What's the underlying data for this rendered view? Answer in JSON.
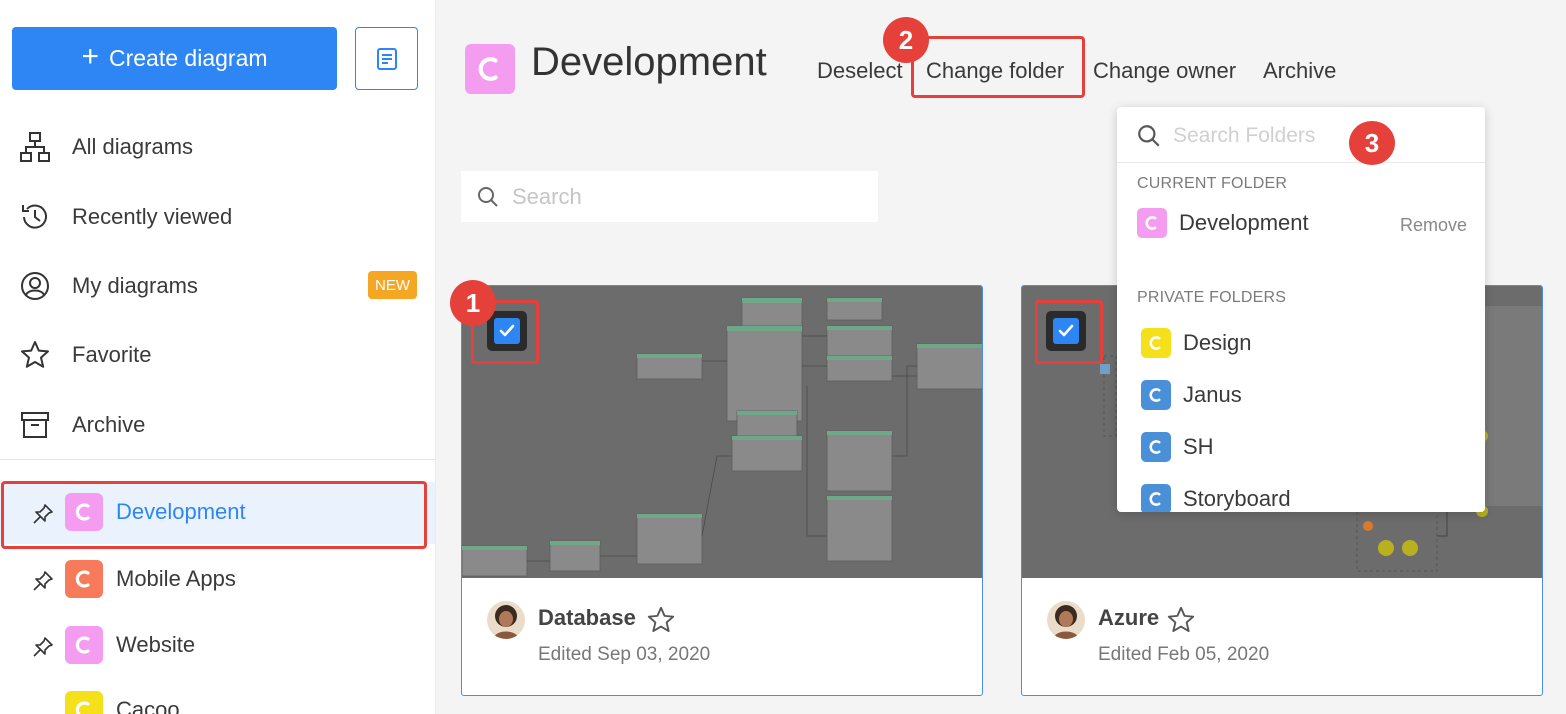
{
  "sidebar": {
    "create_label": "Create diagram",
    "nav": [
      {
        "label": "All diagrams",
        "icon": "hierarchy-icon"
      },
      {
        "label": "Recently viewed",
        "icon": "history-icon"
      },
      {
        "label": "My diagrams",
        "icon": "user-circle-icon",
        "badge": "NEW"
      },
      {
        "label": "Favorite",
        "icon": "star-icon"
      },
      {
        "label": "Archive",
        "icon": "archive-icon"
      }
    ],
    "folders": [
      {
        "label": "Development",
        "color": "#f49cf0",
        "active": true
      },
      {
        "label": "Mobile Apps",
        "color": "#f77a5b"
      },
      {
        "label": "Website",
        "color": "#f49cf0"
      },
      {
        "label": "Cacoo",
        "color": "#f5e11b"
      }
    ]
  },
  "header": {
    "title": "Development",
    "title_color": "#f49cf0",
    "actions": [
      "Deselect",
      "Change folder",
      "Change owner",
      "Archive"
    ]
  },
  "search": {
    "placeholder": "Search"
  },
  "cards": [
    {
      "name": "Database",
      "edited": "Edited Sep 03, 2020",
      "checked": true
    },
    {
      "name": "Azure",
      "edited": "Edited Feb 05, 2020",
      "checked": true
    }
  ],
  "dropdown": {
    "placeholder": "Search Folders",
    "current_header": "CURRENT FOLDER",
    "current": {
      "label": "Development",
      "color": "#f49cf0"
    },
    "remove_label": "Remove",
    "private_header": "PRIVATE FOLDERS",
    "private": [
      {
        "label": "Design",
        "color": "#f5e11b"
      },
      {
        "label": "Janus",
        "color": "#4a90d9"
      },
      {
        "label": "SH",
        "color": "#4a90d9"
      },
      {
        "label": "Storyboard",
        "color": "#4a90d9"
      }
    ]
  },
  "steps": [
    "1",
    "2",
    "3"
  ],
  "colors": {
    "accent": "#2e86f5",
    "highlight": "#e5413a",
    "badge": "#f5a623"
  }
}
